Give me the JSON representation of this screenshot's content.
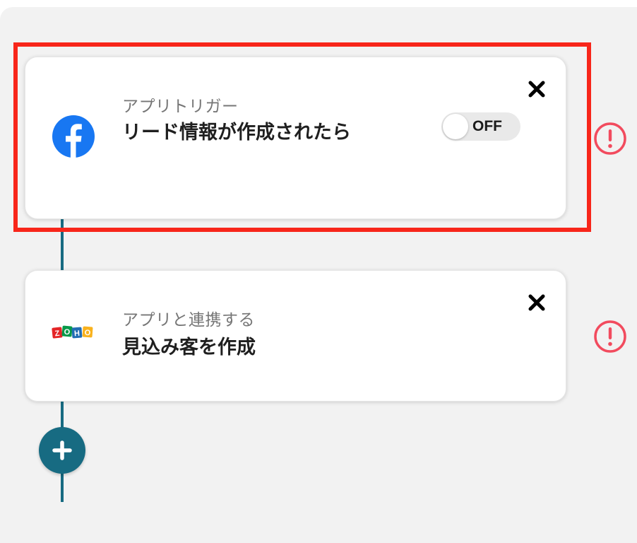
{
  "flow": {
    "steps": [
      {
        "kind": "trigger",
        "app_icon": "facebook-icon",
        "subtitle": "アプリトリガー",
        "title": "リード情報が作成されたら",
        "toggle": {
          "state": "OFF"
        },
        "status_icon": "warning-circle-icon"
      },
      {
        "kind": "action",
        "app_icon": "zoho-icon",
        "subtitle": "アプリと連携する",
        "title": "見込み客を作成",
        "status_icon": "warning-circle-icon"
      }
    ],
    "add_button_icon": "plus-icon"
  },
  "colors": {
    "connector": "#176b82",
    "highlight": "#f8261a",
    "warning": "#f24b5e",
    "facebook": "#1877f2"
  }
}
